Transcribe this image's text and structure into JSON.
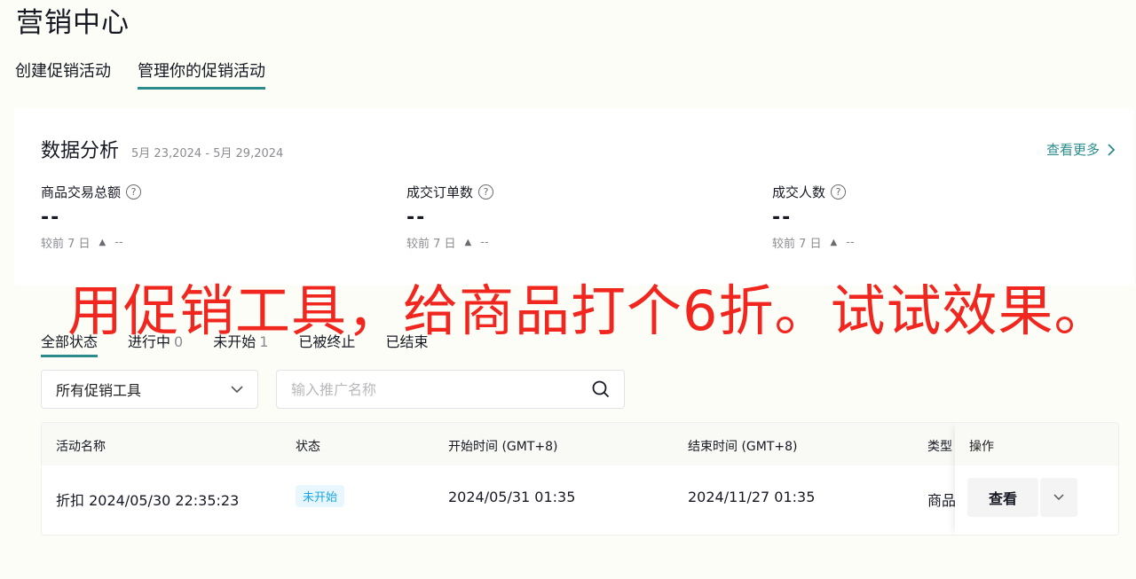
{
  "page": {
    "title": "营销中心"
  },
  "top_tabs": [
    {
      "label": "创建促销活动",
      "active": false
    },
    {
      "label": "管理你的促销活动",
      "active": true
    }
  ],
  "analytics": {
    "title": "数据分析",
    "date_range": "5月 23,2024 - 5月 29,2024",
    "more_label": "查看更多",
    "compare_label": "较前 7 日",
    "metrics": [
      {
        "label": "商品交易总额",
        "value": "--",
        "change": "--"
      },
      {
        "label": "成交订单数",
        "value": "--",
        "change": "--"
      },
      {
        "label": "成交人数",
        "value": "--",
        "change": "--"
      }
    ]
  },
  "overlay_text": "用促销工具，给商品打个6折。试试效果。",
  "status_tabs": [
    {
      "label": "全部状态",
      "count": "",
      "active": true
    },
    {
      "label": "进行中",
      "count": "0",
      "active": false
    },
    {
      "label": "未开始",
      "count": "1",
      "active": false
    },
    {
      "label": "已被终止",
      "count": "",
      "active": false
    },
    {
      "label": "已结束",
      "count": "",
      "active": false
    }
  ],
  "filter": {
    "tool_select": "所有促销工具",
    "search_placeholder": "输入推广名称"
  },
  "table": {
    "headers": {
      "name": "活动名称",
      "status": "状态",
      "start": "开始时间 (GMT+8)",
      "end": "结束时间 (GMT+8)",
      "type": "类型",
      "action": "操作"
    },
    "rows": [
      {
        "name": "折扣 2024/05/30 22:35:23",
        "status": "未开始",
        "start": "2024/05/31 01:35",
        "end": "2024/11/27 01:35",
        "type": "商品",
        "action": "查看"
      }
    ]
  },
  "colors": {
    "accent": "#2a8c8c",
    "overlay": "#f0261f",
    "badge_text": "#1aa5e3",
    "badge_bg": "#e8f7fd"
  }
}
